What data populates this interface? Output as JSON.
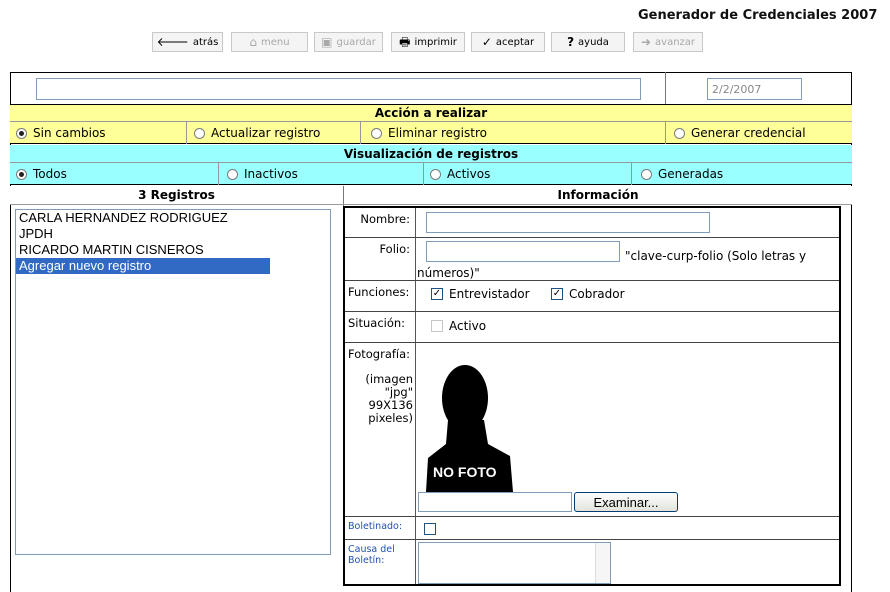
{
  "app_title": "Generador de Credenciales 2007",
  "toolbar": {
    "back": "atrás",
    "menu": "menu",
    "save": "guardar",
    "print": "imprimir",
    "accept": "aceptar",
    "help": "ayuda",
    "forward": "avanzar"
  },
  "header": {
    "search_value": "",
    "date": "2/2/2007"
  },
  "accion": {
    "title": "Acción a realizar",
    "options": [
      "Sin cambios",
      "Actualizar registro",
      "Eliminar registro",
      "Generar credencial"
    ],
    "selected": "Sin cambios"
  },
  "visualizacion": {
    "title": "Visualización de registros",
    "options": [
      "Todos",
      "Inactivos",
      "Activos",
      "Generadas"
    ],
    "selected": "Todos"
  },
  "registros": {
    "title": "3 Registros",
    "items": [
      "CARLA HERNANDEZ RODRIGUEZ",
      "JPDH",
      "RICARDO MARTIN CISNEROS",
      "Agregar nuevo registro"
    ],
    "selected": "Agregar nuevo registro"
  },
  "info": {
    "title": "Información",
    "nombre_label": "Nombre:",
    "nombre_value": "",
    "folio_label": "Folio:",
    "folio_value": "",
    "folio_hint_a": "\"clave-curp-folio (Solo letras y",
    "folio_hint_b": "números)\"",
    "funciones_label": "Funciones:",
    "entrevistador_label": "Entrevistador",
    "entrevistador_checked": true,
    "cobrador_label": "Cobrador",
    "cobrador_checked": true,
    "situacion_label": "Situación:",
    "activo_label": "Activo",
    "activo_checked": false,
    "foto_label": "Fotografía:",
    "foto_hint": [
      "(imagen",
      "\"jpg\"",
      "99X136",
      "pixeles)"
    ],
    "no_foto_text": "NO FOTO",
    "file_value": "",
    "examinar_label": "Examinar...",
    "boletinado_label": "Boletinado:",
    "boletinado_checked": false,
    "causa_label": [
      "Causa del",
      "Boletín:"
    ],
    "causa_value": ""
  },
  "colors": {
    "accion_band": "#ffff99",
    "visual_band": "#99ffff",
    "selection": "#316ac5",
    "input_border": "#7f9db9"
  },
  "icons": {
    "back": "arrow-left-icon",
    "menu": "home-icon",
    "save": "floppy-disk-icon",
    "print": "printer-icon",
    "accept": "checkmark-icon",
    "help": "question-mark-icon",
    "forward": "arrow-right-icon"
  }
}
